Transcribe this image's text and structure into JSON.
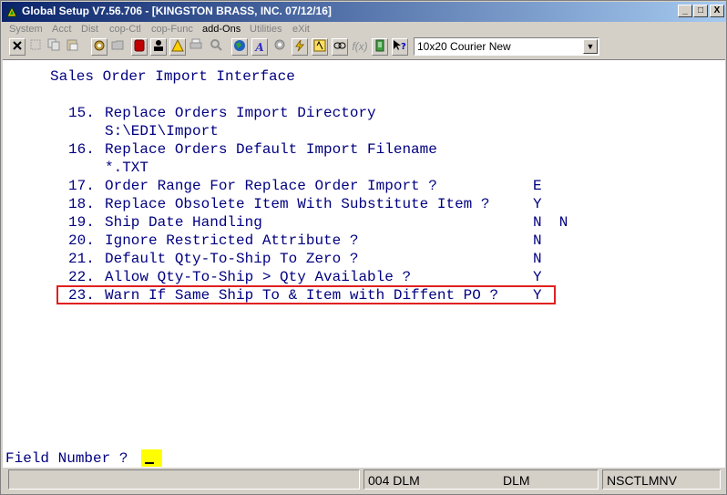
{
  "window": {
    "title": "Global Setup V7.56.706 - [KINGSTON BRASS, INC. 07/12/16]",
    "buttons": {
      "minimize": "_",
      "maximize": "□",
      "close": "X"
    }
  },
  "menu": [
    {
      "label": "System",
      "enabled": false
    },
    {
      "label": "Acct",
      "enabled": false
    },
    {
      "label": "Dist",
      "enabled": false
    },
    {
      "label": "cop-Ctl",
      "enabled": false
    },
    {
      "label": "cop-Func",
      "enabled": false
    },
    {
      "label": "add-Ons",
      "enabled": true
    },
    {
      "label": "Utilities",
      "enabled": false
    },
    {
      "label": "eXit",
      "enabled": false
    }
  ],
  "toolbar": {
    "font_selector": "10x20 Courier New",
    "icons": [
      "close-icon",
      "blank-icon",
      "copy-icon",
      "paste-icon",
      "settings-icon",
      "folder-icon",
      "stop-icon",
      "user-icon",
      "warning-icon",
      "print-icon",
      "search-icon",
      "globe-icon",
      "font-icon",
      "gear-icon",
      "lightning-icon",
      "help-icon",
      "link-icon",
      "function-icon",
      "document-icon",
      "what-is-this-icon"
    ]
  },
  "screen": {
    "heading": "Sales Order Import Interface",
    "lines": [
      {
        "num": "15.",
        "text": "Replace Orders Import Directory",
        "value": ""
      },
      {
        "num": "",
        "text": "S:\\EDI\\Import",
        "value": ""
      },
      {
        "num": "16.",
        "text": "Replace Orders Default Import Filename",
        "value": ""
      },
      {
        "num": "",
        "text": "*.TXT",
        "value": ""
      },
      {
        "num": "17.",
        "text": "Order Range For Replace Order Import ?",
        "value": "E"
      },
      {
        "num": "18.",
        "text": "Replace Obsolete Item With Substitute Item ?",
        "value": "Y"
      },
      {
        "num": "19.",
        "text": "Ship Date Handling",
        "value": "N  N"
      },
      {
        "num": "20.",
        "text": "Ignore Restricted Attribute ?",
        "value": "N"
      },
      {
        "num": "21.",
        "text": "Default Qty-To-Ship To Zero ?",
        "value": "N"
      },
      {
        "num": "22.",
        "text": "Allow Qty-To-Ship > Qty Available ?",
        "value": "Y"
      },
      {
        "num": "23.",
        "text": "Warn If Same Ship To & Item with Diffent PO ?",
        "value": "Y"
      }
    ]
  },
  "prompt": {
    "label": "Field Number ?"
  },
  "status": {
    "left": "",
    "company": "004 DLM",
    "user": "DLM",
    "program": "NSCTLMNV"
  },
  "colors": {
    "terminal_text": "#000080",
    "highlight": "#e02020",
    "cursor": "#ffff00"
  }
}
